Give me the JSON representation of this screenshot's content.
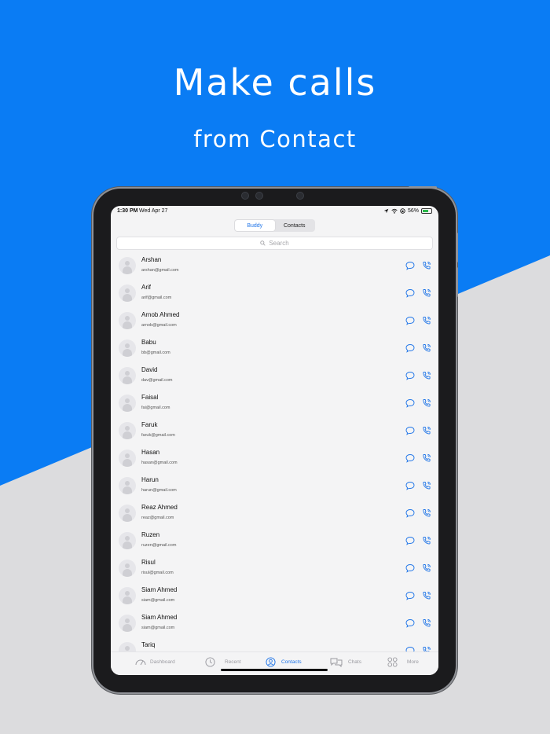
{
  "promo": {
    "headline": "Make calls",
    "subheadline": "from Contact",
    "colors": {
      "blue": "#0a7cf4",
      "gray": "#dcdcde"
    }
  },
  "status_bar": {
    "time": "1:30 PM",
    "date": "Wed Apr 27",
    "battery": "56%"
  },
  "segmented": {
    "items": [
      {
        "label": "Buddy",
        "active": true
      },
      {
        "label": "Contacts",
        "active": false
      }
    ]
  },
  "search": {
    "placeholder": "Search",
    "icon": "search-icon"
  },
  "contacts": [
    {
      "name": "Arshan",
      "email": "arshan@gmail.com"
    },
    {
      "name": "Arif",
      "email": "arif@gmail.com"
    },
    {
      "name": "Arnob Ahmed",
      "email": "arnob@gmail.com"
    },
    {
      "name": "Babu",
      "email": "bb@gmail.com"
    },
    {
      "name": "David",
      "email": "dav@gmail.com"
    },
    {
      "name": "Faisal",
      "email": "fai@gmail.com"
    },
    {
      "name": "Faruk",
      "email": "faruk@gmail.com"
    },
    {
      "name": "Hasan",
      "email": "hasan@gmail.com"
    },
    {
      "name": "Harun",
      "email": "harun@gmail.com"
    },
    {
      "name": "Reaz Ahmed",
      "email": "reaz@gmail.com"
    },
    {
      "name": "Ruzen",
      "email": "ruzen@gmail.com"
    },
    {
      "name": "Risul",
      "email": "risul@gmail.com"
    },
    {
      "name": "Siam Ahmed",
      "email": "siam@gmail.com"
    },
    {
      "name": "Siam Ahmed",
      "email": "siam@gmail.com"
    },
    {
      "name": "Tariq",
      "email": ""
    }
  ],
  "row_actions": {
    "chat_icon": "chat-bubble-icon",
    "call_icon": "phone-call-icon"
  },
  "tabbar": {
    "items": [
      {
        "label": "Dashboard",
        "icon": "dashboard-icon",
        "active": false
      },
      {
        "label": "Recent",
        "icon": "clock-icon",
        "active": false
      },
      {
        "label": "Contacts",
        "icon": "contacts-icon",
        "active": true
      },
      {
        "label": "Chats",
        "icon": "chats-icon",
        "active": false
      },
      {
        "label": "More",
        "icon": "grid-icon",
        "active": false
      }
    ],
    "colors": {
      "active": "#2176e8",
      "inactive": "#9a9aa0"
    }
  }
}
